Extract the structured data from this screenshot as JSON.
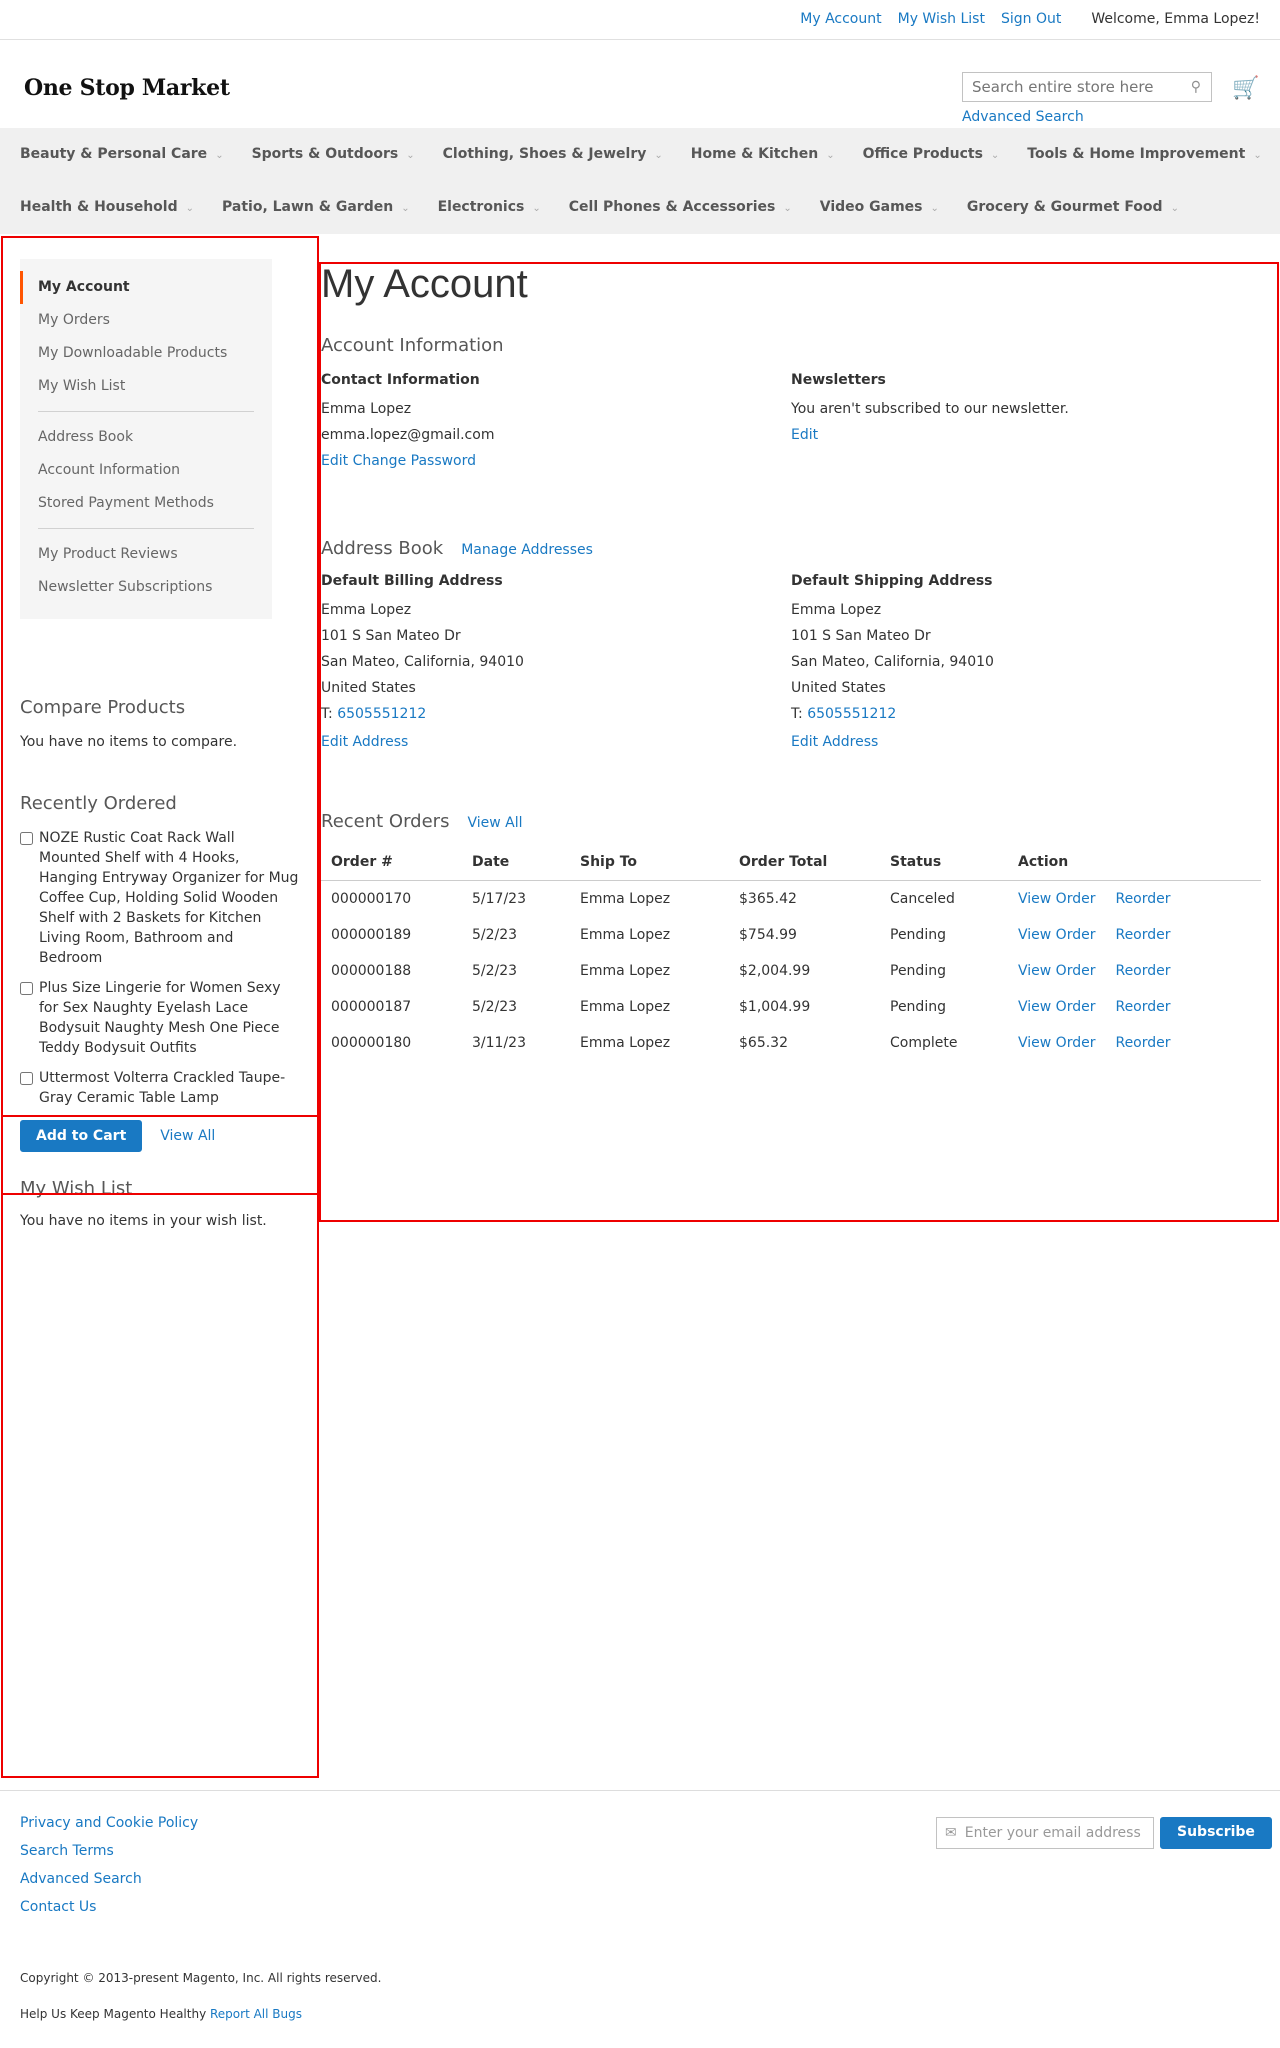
{
  "header": {
    "top_links": [
      "My Account",
      "My Wish List",
      "Sign Out"
    ],
    "welcome": "Welcome, Emma Lopez!",
    "logo": "One Stop Market",
    "search_placeholder": "Search entire store here...",
    "advanced_search": "Advanced Search"
  },
  "nav": {
    "row1": [
      "Beauty & Personal Care",
      "Sports & Outdoors",
      "Clothing, Shoes & Jewelry",
      "Home & Kitchen",
      "Office Products",
      "Tools & Home Improvement"
    ],
    "row2": [
      "Health & Household",
      "Patio, Lawn & Garden",
      "Electronics",
      "Cell Phones & Accessories",
      "Video Games",
      "Grocery & Gourmet Food"
    ]
  },
  "sidebar": {
    "items": [
      "My Account",
      "My Orders",
      "My Downloadable Products",
      "My Wish List",
      "Address Book",
      "Account Information",
      "Stored Payment Methods",
      "My Product Reviews",
      "Newsletter Subscriptions"
    ],
    "compare": {
      "title": "Compare Products",
      "text": "You have no items to compare."
    },
    "recently_ordered": {
      "title": "Recently Ordered",
      "items": [
        "NOZE Rustic Coat Rack Wall Mounted Shelf with 4 Hooks, Hanging Entryway Organizer for Mug Coffee Cup, Holding Solid Wooden Shelf with 2 Baskets for Kitchen Living Room, Bathroom and Bedroom",
        "Plus Size Lingerie for Women Sexy for Sex Naughty Eyelash Lace Bodysuit Naughty Mesh One Piece Teddy Bodysuit Outfits",
        "Uttermost Volterra Crackled Taupe-Gray Ceramic Table Lamp"
      ],
      "add_to_cart": "Add to Cart",
      "view_all": "View All"
    },
    "wishlist": {
      "title": "My Wish List",
      "text": "You have no items in your wish list."
    }
  },
  "main": {
    "title": "My Account",
    "account_info": {
      "title": "Account Information",
      "contact_title": "Contact Information",
      "name": "Emma Lopez",
      "email": "emma.lopez@gmail.com",
      "edit": "Edit",
      "change_password": "Change Password",
      "newsletters_title": "Newsletters",
      "newsletters_text": "You aren't subscribed to our newsletter.",
      "newsletters_edit": "Edit"
    },
    "address_book": {
      "title": "Address Book",
      "manage": "Manage Addresses",
      "billing": {
        "title": "Default Billing Address",
        "name": "Emma Lopez",
        "street": "101 S San Mateo Dr",
        "city": "San Mateo, California, 94010",
        "country": "United States",
        "phone_label": "T:",
        "phone": "6505551212",
        "edit": "Edit Address"
      },
      "shipping": {
        "title": "Default Shipping Address",
        "name": "Emma Lopez",
        "street": "101 S San Mateo Dr",
        "city": "San Mateo, California, 94010",
        "country": "United States",
        "phone_label": "T:",
        "phone": "6505551212",
        "edit": "Edit Address"
      }
    },
    "recent_orders": {
      "title": "Recent Orders",
      "view_all": "View All",
      "columns": [
        "Order #",
        "Date",
        "Ship To",
        "Order Total",
        "Status",
        "Action"
      ],
      "rows": [
        {
          "order": "000000170",
          "date": "5/17/23",
          "ship_to": "Emma Lopez",
          "total": "$365.42",
          "status": "Canceled"
        },
        {
          "order": "000000189",
          "date": "5/2/23",
          "ship_to": "Emma Lopez",
          "total": "$754.99",
          "status": "Pending"
        },
        {
          "order": "000000188",
          "date": "5/2/23",
          "ship_to": "Emma Lopez",
          "total": "$2,004.99",
          "status": "Pending"
        },
        {
          "order": "000000187",
          "date": "5/2/23",
          "ship_to": "Emma Lopez",
          "total": "$1,004.99",
          "status": "Pending"
        },
        {
          "order": "000000180",
          "date": "3/11/23",
          "ship_to": "Emma Lopez",
          "total": "$65.32",
          "status": "Complete"
        }
      ],
      "view_order": "View Order",
      "reorder": "Reorder"
    }
  },
  "footer": {
    "links": [
      "Privacy and Cookie Policy",
      "Search Terms",
      "Advanced Search",
      "Contact Us"
    ],
    "newsletter_placeholder": "Enter your email address",
    "subscribe": "Subscribe",
    "copyright": "Copyright © 2013-present Magento, Inc. All rights reserved.",
    "help_text": "Help Us Keep Magento Healthy",
    "report_bugs": "Report All Bugs"
  },
  "colors": {
    "link": "#1979c3",
    "accent": "#ff5501",
    "nav_bg": "#f0f0f0",
    "annotation": "#e00000"
  }
}
